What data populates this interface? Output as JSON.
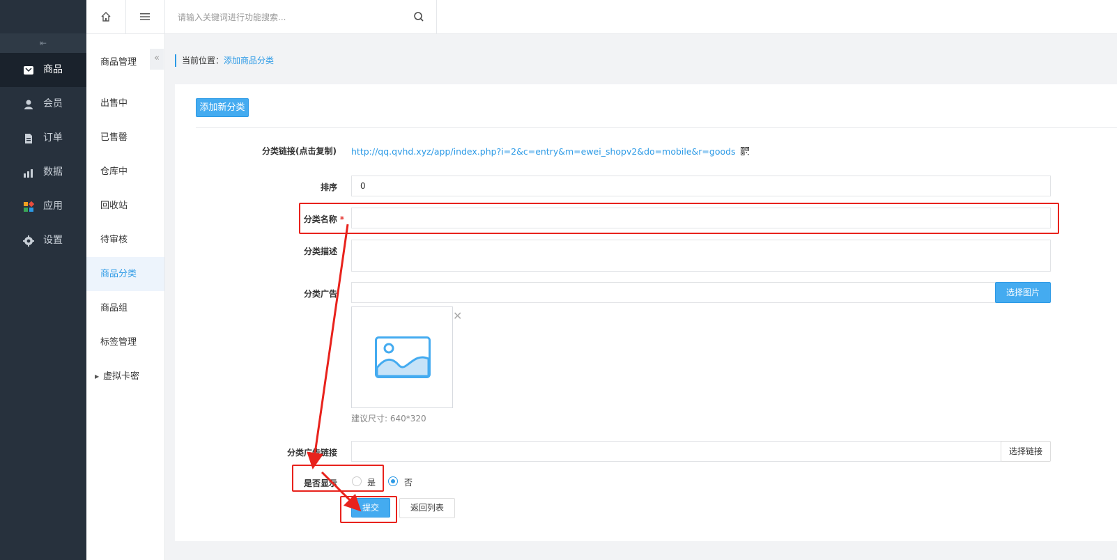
{
  "sidebar": {
    "collapse_glyph": "⇤",
    "items": [
      {
        "label": "商品",
        "icon": "goods-icon"
      },
      {
        "label": "会员",
        "icon": "member-icon"
      },
      {
        "label": "订单",
        "icon": "order-icon"
      },
      {
        "label": "数据",
        "icon": "data-icon"
      },
      {
        "label": "应用",
        "icon": "apps-icon"
      },
      {
        "label": "设置",
        "icon": "settings-icon"
      }
    ],
    "active_index": 0
  },
  "subnav": {
    "title": "商品管理",
    "collapse_glyph": "«",
    "items": [
      {
        "label": "出售中"
      },
      {
        "label": "已售罄"
      },
      {
        "label": "仓库中"
      },
      {
        "label": "回收站"
      },
      {
        "label": "待审核"
      },
      {
        "label": "商品分类"
      },
      {
        "label": "商品组"
      },
      {
        "label": "标签管理"
      }
    ],
    "group": {
      "label": "虚拟卡密",
      "caret": "▶"
    },
    "active_index": 5
  },
  "header": {
    "search_placeholder": "请输入关键词进行功能搜索..."
  },
  "breadcrumb": {
    "prefix": "当前位置：",
    "current": "添加商品分类"
  },
  "panel": {
    "add_button": "添加新分类",
    "form": {
      "link_label": "分类链接(点击复制)",
      "link_url": "http://qq.qvhd.xyz/app/index.php?i=2&c=entry&m=ewei_shopv2&do=mobile&r=goods",
      "sort_label": "排序",
      "sort_value": "0",
      "name_label": "分类名称",
      "required_mark": "*",
      "name_value": "",
      "desc_label": "分类描述",
      "desc_value": "",
      "ad_label": "分类广告",
      "ad_value": "",
      "choose_image_button": "选择图片",
      "image_close_glyph": "✕",
      "size_hint": "建议尺寸: 640*320",
      "ad_link_label": "分类广告链接",
      "ad_link_value": "",
      "choose_link_button": "选择链接",
      "show_label": "是否显示",
      "show_options": [
        {
          "label": "是",
          "checked": false
        },
        {
          "label": "否",
          "checked": true
        }
      ],
      "submit_button": "提交",
      "back_button": "返回列表"
    }
  },
  "annotation_color": "#e8221c",
  "accent_color": "#2c9ae6"
}
